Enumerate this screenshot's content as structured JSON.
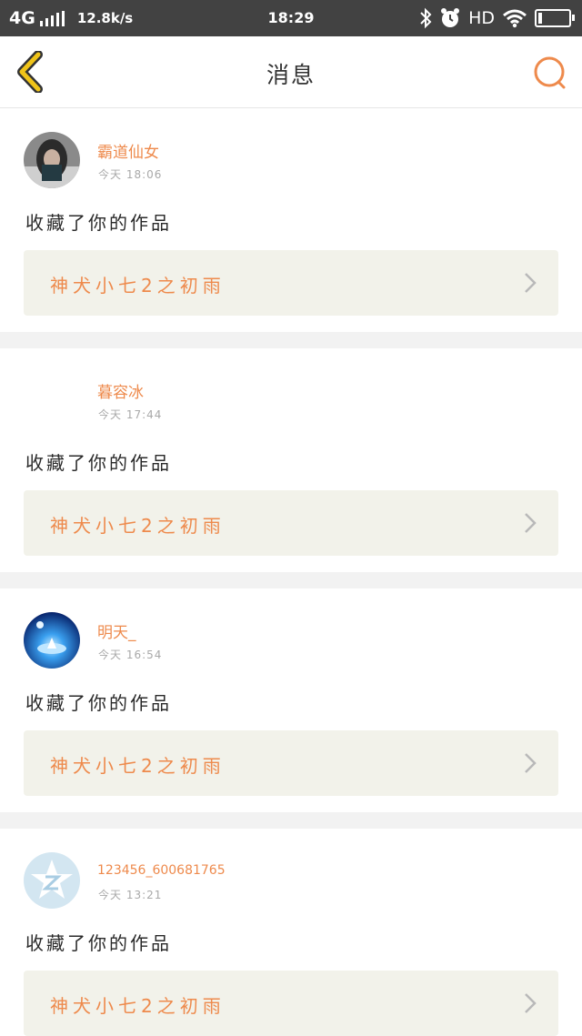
{
  "status_bar": {
    "network": "4G",
    "speed": "12.8k/s",
    "time": "18:29",
    "hd": "HD",
    "icons": [
      "signal-icon",
      "bluetooth-icon",
      "alarm-icon",
      "wifi-icon",
      "battery-icon"
    ]
  },
  "nav": {
    "title": "消息",
    "back_icon": "chevron-left-icon",
    "search_icon": "search-icon"
  },
  "colors": {
    "accent": "#ee8a4c",
    "back_icon": "#f0c419",
    "status_bar_bg": "#424242",
    "card_bg": "#f2f2ea"
  },
  "messages": [
    {
      "user": "霸道仙女",
      "time": "今天 18:06",
      "action": "收藏了你的作品",
      "work": "神犬小七2之初雨"
    },
    {
      "user": "暮容冰",
      "time": "今天 17:44",
      "action": "收藏了你的作品",
      "work": "神犬小七2之初雨"
    },
    {
      "user": "明天_",
      "time": "今天 16:54",
      "action": "收藏了你的作品",
      "work": "神犬小七2之初雨"
    },
    {
      "user": "123456_600681765",
      "time": "今天 13:21",
      "action": "收藏了你的作品",
      "work": "神犬小七2之初雨"
    }
  ]
}
